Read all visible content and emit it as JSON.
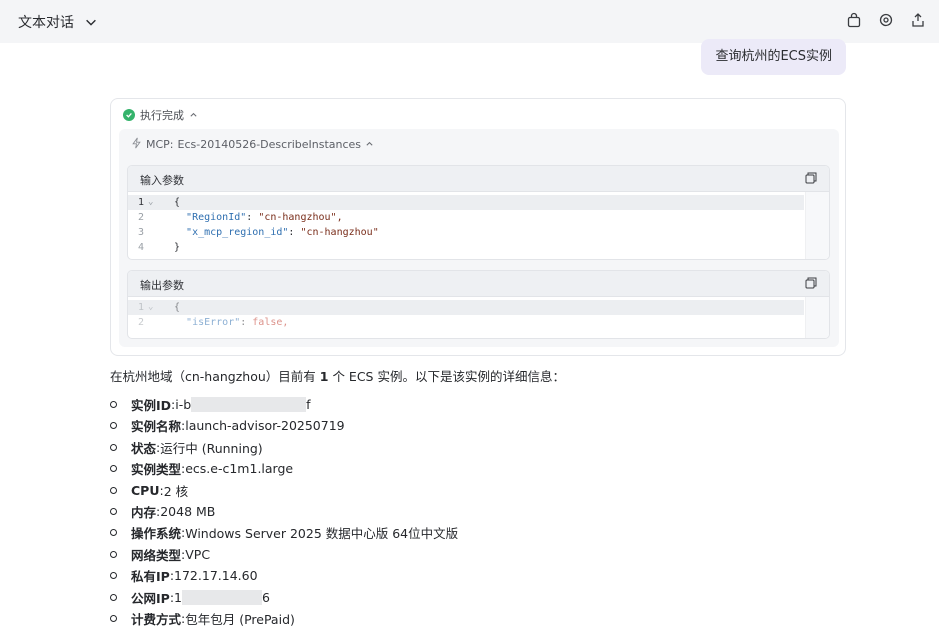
{
  "header": {
    "title": "文本对话",
    "icons": [
      "bag-icon",
      "settings-icon",
      "share-icon"
    ]
  },
  "user_message": "查询杭州的ECS实例",
  "execution": {
    "status": "执行完成",
    "mcp_prefix": "MCP:",
    "mcp_tool": "Ecs-20140526-DescribeInstances",
    "input": {
      "label": "输入参数",
      "lines": [
        {
          "num": "1",
          "text": "{"
        },
        {
          "num": "2",
          "key": "\"RegionId\"",
          "value": "\"cn-hangzhou\","
        },
        {
          "num": "3",
          "key": "\"x_mcp_region_id\"",
          "value": "\"cn-hangzhou\""
        },
        {
          "num": "4",
          "text": "}"
        }
      ]
    },
    "output": {
      "label": "输出参数",
      "lines": [
        {
          "num": "1",
          "text": "{"
        },
        {
          "num": "2",
          "key": "\"isError\"",
          "value": "false,"
        }
      ]
    }
  },
  "answer": {
    "intro_before": "在杭州地域（cn-hangzhou）目前有 ",
    "intro_count": "1",
    "intro_after": " 个 ECS 实例。以下是该实例的详细信息：",
    "items": [
      {
        "key": "实例ID",
        "value": "i-b",
        "suffix": "f",
        "masked": true
      },
      {
        "key": "实例名称",
        "value": "launch-advisor-20250719"
      },
      {
        "key": "状态",
        "value": "运行中 (Running)"
      },
      {
        "key": "实例类型",
        "value": "ecs.e-c1m1.large"
      },
      {
        "key": "CPU",
        "value": "2 核"
      },
      {
        "key": "内存",
        "value": "2048 MB"
      },
      {
        "key": "操作系统",
        "value": "Windows Server 2025 数据中心版 64位中文版"
      },
      {
        "key": "网络类型",
        "value": "VPC"
      },
      {
        "key": "私有IP",
        "value": "172.17.14.60"
      },
      {
        "key": "公网IP",
        "value": "1",
        "suffix": "6",
        "masked": true
      },
      {
        "key": "计费方式",
        "value": "包年包月 (PrePaid)"
      }
    ]
  }
}
